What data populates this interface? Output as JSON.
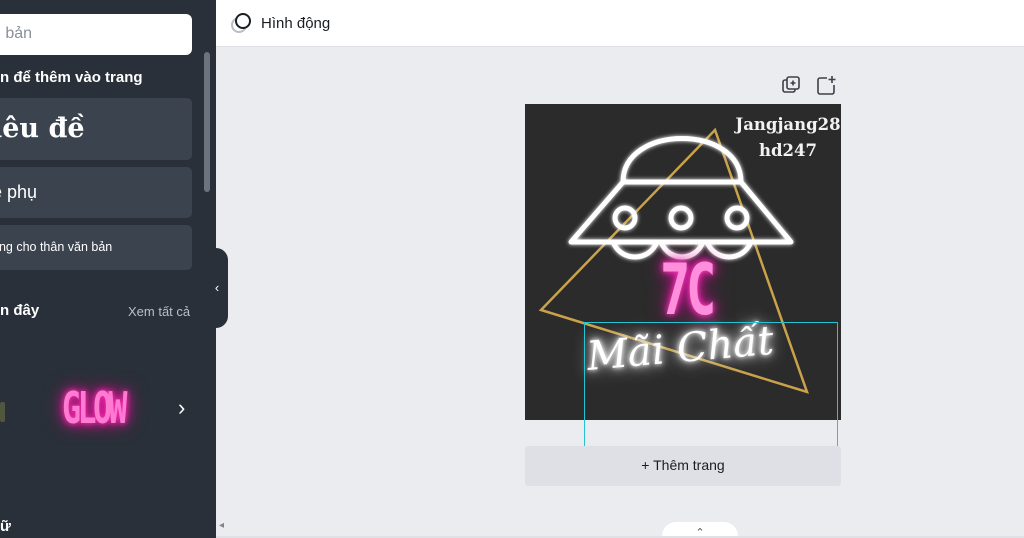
{
  "sidebar": {
    "search_placeholder": "n bản",
    "add_heading": "n để thêm vào trang",
    "cards": {
      "heading": "iêu đề",
      "subheading": "ề phụ",
      "body": "ung cho thân văn bản"
    },
    "recent_heading": "n đây",
    "see_all": "Xem tất cả",
    "glow_label": "GLOW",
    "bottom_heading": "ữ"
  },
  "topbar": {
    "animation_label": "Hình động"
  },
  "canvas": {
    "watermark": [
      "Jangjang28",
      "hd247"
    ],
    "main_text": "7C",
    "script_text": "Mãi Chất",
    "add_page_label": "+ Thêm trang"
  },
  "colors": {
    "sidebar_bg": "#293039",
    "card_bg": "#3a434e",
    "canvas_bg": "#ebecf0",
    "design_bg": "#2b2b2b",
    "selection": "#23c4d4",
    "neon_pink": "#ff8fdc",
    "gold_line": "#c9a24a"
  },
  "icons": {
    "animation": "animation-icon",
    "duplicate": "duplicate-page-icon",
    "add_page": "add-page-icon",
    "collapse": "chevron-left-icon",
    "carousel_next": "chevron-right-icon",
    "notes": "chevron-up-icon"
  }
}
